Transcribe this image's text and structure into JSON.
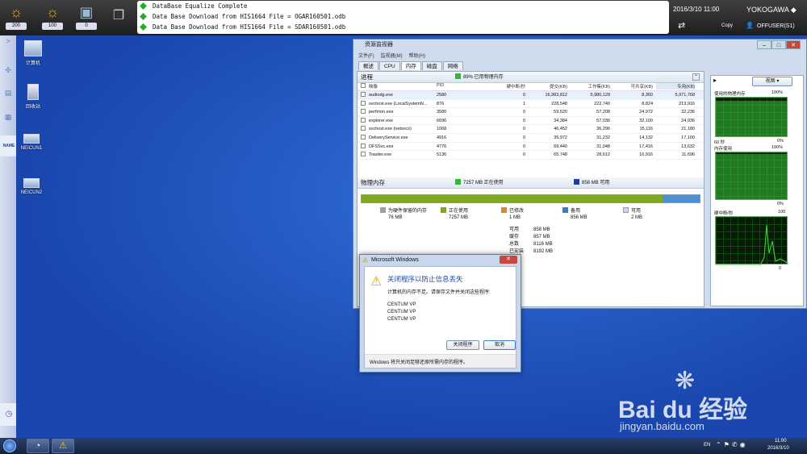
{
  "toolbar": {
    "buttons": [
      {
        "name": "alarm-200",
        "count": "200"
      },
      {
        "name": "alarm-100",
        "count": "100"
      },
      {
        "name": "message",
        "count": "0"
      }
    ]
  },
  "messages": [
    "DataBase Equalize Complete",
    "Data Base Download from HIS1664 File = OGAR160501.odb",
    "Data Base Download from HIS1664 File = SDAR160501.odb"
  ],
  "header": {
    "datetime": "2016/3/10 11:00",
    "brand": "YOKOGAWA ◆",
    "copy": "Copy",
    "user": "OFFUSER(S1)"
  },
  "leftbar": {
    "name_label": "NAME"
  },
  "desktop": {
    "icons": [
      "计算机",
      "回收站",
      "NEICUN1",
      "NEICUN2"
    ]
  },
  "taskmgr": {
    "title": "资源监视器",
    "menu": [
      "文件(F)",
      "监视器(M)",
      "帮助(H)"
    ],
    "tabs": [
      "概述",
      "CPU",
      "内存",
      "磁盘",
      "网络"
    ],
    "process_section": "进程",
    "process_usage": "89% 已用物理内存",
    "columns": [
      "映像",
      "PID",
      "硬中断/秒",
      "提交(KB)",
      "工作集(KB)",
      "可共享(KB)",
      "专用(KB)"
    ],
    "rows": [
      [
        "audiodg.exe",
        "2580",
        "0",
        "16,983,812",
        "5,980,128",
        "8,360",
        "5,971,768"
      ],
      [
        "svchost.exe (LocalSystemN...",
        "876",
        "1",
        "228,548",
        "222,740",
        "8,824",
        "213,916"
      ],
      [
        "perfmon.exe",
        "3580",
        "0",
        "59,520",
        "57,208",
        "24,972",
        "32,236"
      ],
      [
        "explorer.exe",
        "6696",
        "0",
        "34,384",
        "57,036",
        "32,100",
        "24,936"
      ],
      [
        "svchost.exe (netsvcs)",
        "1068",
        "0",
        "46,452",
        "36,296",
        "15,116",
        "21,180"
      ],
      [
        "DeliveryService.exe",
        "4916",
        "0",
        "35,972",
        "31,232",
        "14,132",
        "17,100"
      ],
      [
        "DFSSvc.exe",
        "4776",
        "0",
        "69,440",
        "31,048",
        "17,416",
        "13,632"
      ],
      [
        "Toaster.exe",
        "5136",
        "0",
        "65,748",
        "28,612",
        "16,916",
        "11,696"
      ]
    ],
    "memory_section": "物理内存",
    "mem_inuse": "7257 MB 正在使用",
    "mem_avail": "858 MB 可用",
    "mem_fraction": 0.89,
    "legend": [
      {
        "label": "为硬件保留的内存",
        "value": "76 MB",
        "color": "#a0a0a0"
      },
      {
        "label": "正在使用",
        "value": "7257 MB",
        "color": "#7fa820"
      },
      {
        "label": "已修改",
        "value": "1 MB",
        "color": "#e08a1a"
      },
      {
        "label": "备用",
        "value": "856 MB",
        "color": "#3e7ac8"
      },
      {
        "label": "可用",
        "value": "2 MB",
        "color": "#c8d8f0"
      }
    ],
    "stats": [
      [
        "可用",
        "858 MB"
      ],
      [
        "缓存",
        "857 MB"
      ],
      [
        "总数",
        "8116 MB"
      ],
      [
        "已安装",
        "8192 MB"
      ]
    ],
    "view_label": "视图",
    "graphs": [
      {
        "title": "使用的物理内存",
        "max": "100%",
        "left": "60 秒",
        "right": "0%"
      },
      {
        "title": "内存使用",
        "max": "100%",
        "right": "0%"
      },
      {
        "title": "硬中断/秒",
        "max": "100",
        "right": "0"
      }
    ]
  },
  "dialog": {
    "title": "Microsoft Windows",
    "heading": "关闭程序以防止信息丢失",
    "body": "计算机的内存不足。请保存文件并关闭这些程序:",
    "programs": [
      "CENTUM VP",
      "CENTUM VP",
      "CENTUM VP"
    ],
    "close_btn": "关闭程序",
    "cancel_btn": "取消",
    "footer": "Windows 将只关闭足够还原所需内存的程序。"
  },
  "taskbar": {
    "lang": "EN",
    "time": "11:00",
    "date": "2016/3/10"
  },
  "watermark": {
    "brand": "Bai du 经验",
    "url": "jingyan.baidu.com"
  }
}
